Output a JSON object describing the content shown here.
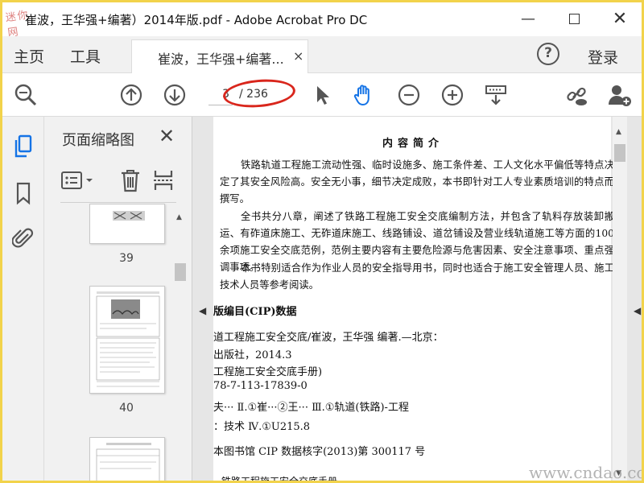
{
  "window": {
    "logo_text": "迷你网",
    "title": "崔波，王华强+编著）2014年版.pdf - Adobe Acrobat Pro DC",
    "minimize_label": "—",
    "close_label": "✕"
  },
  "menubar": {
    "home": "主页",
    "tools": "工具",
    "tab_label": "崔波，王华强+编著...",
    "tab_close": "×",
    "help": "?",
    "login": "登录"
  },
  "toolbar": {
    "current_page": "3",
    "total_pages": "/ 236"
  },
  "thumbnails": {
    "panel_title": "页面缩略图",
    "close": "✕",
    "pages": [
      {
        "label": "39"
      },
      {
        "label": "40"
      }
    ]
  },
  "document": {
    "intro_title": "内容简介",
    "paragraphs": [
      "铁路轨道工程施工流动性强、临时设施多、施工条件差、工人文化水平偏低等特点决定了其安全风险高。安全无小事，细节决定成败，本书即针对工人专业素质培训的特点而撰写。",
      "全书共分八章，阐述了铁路工程施工安全交底编制方法，并包含了轨料存放装卸搬运、有砟道床施工、无砟道床施工、线路铺设、道岔铺设及营业线轨道施工等方面的100余项施工安全交底范例，范例主要内容有主要危险源与危害因素、安全注意事项、重点强调事项。",
      "本书特别适合作为作业人员的安全指导用书，同时也适合于施工安全管理人员、施工技术人员等参考阅读。"
    ],
    "cip_title": "版编目(CIP)数据",
    "cip_lines": [
      "道工程施工安全交底/崔波，王华强   编著.—北京：",
      "出版社，2014.3",
      "工程施工安全交底手册)",
      "78-7-113-17839-0",
      "夫···   Ⅱ.①崔···②王···    Ⅲ.①轨道(铁路)-工程",
      "：技术   Ⅳ.①U215.8",
      "本图书馆 CIP 数据核字(2013)第 300117 号",
      "铁路工程施工安全交底手册"
    ]
  },
  "watermark": "www.cndao.com",
  "colors": {
    "accent_blue": "#1473e6",
    "annotation_red": "#d9261c",
    "frame_yellow": "#f2d34b"
  }
}
